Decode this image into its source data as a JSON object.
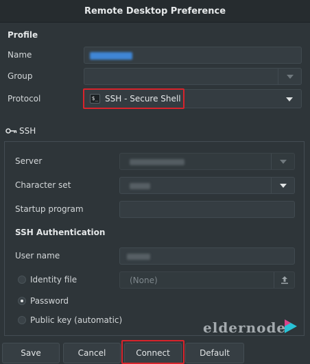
{
  "window": {
    "title": "Remote Desktop Preference"
  },
  "profile": {
    "heading": "Profile",
    "name_label": "Name",
    "group_label": "Group",
    "protocol_label": "Protocol",
    "protocol_value": "SSH - Secure Shell"
  },
  "tab": {
    "label": "SSH"
  },
  "ssh": {
    "server_label": "Server",
    "charset_label": "Character set",
    "startup_label": "Startup program",
    "auth_heading": "SSH Authentication",
    "username_label": "User name",
    "identity_label": "Identity file",
    "identity_value": "(None)",
    "password_label": "Password",
    "pubkey_label": "Public key (automatic)",
    "selected_auth": "Password"
  },
  "buttons": {
    "save": "Save",
    "cancel": "Cancel",
    "connect": "Connect",
    "default": "Default"
  },
  "watermark": {
    "text": "eldernode"
  },
  "colors": {
    "highlight_box": "#d9232b",
    "redacted_name": "#3f86d6",
    "window_bg": "#2e3539"
  }
}
